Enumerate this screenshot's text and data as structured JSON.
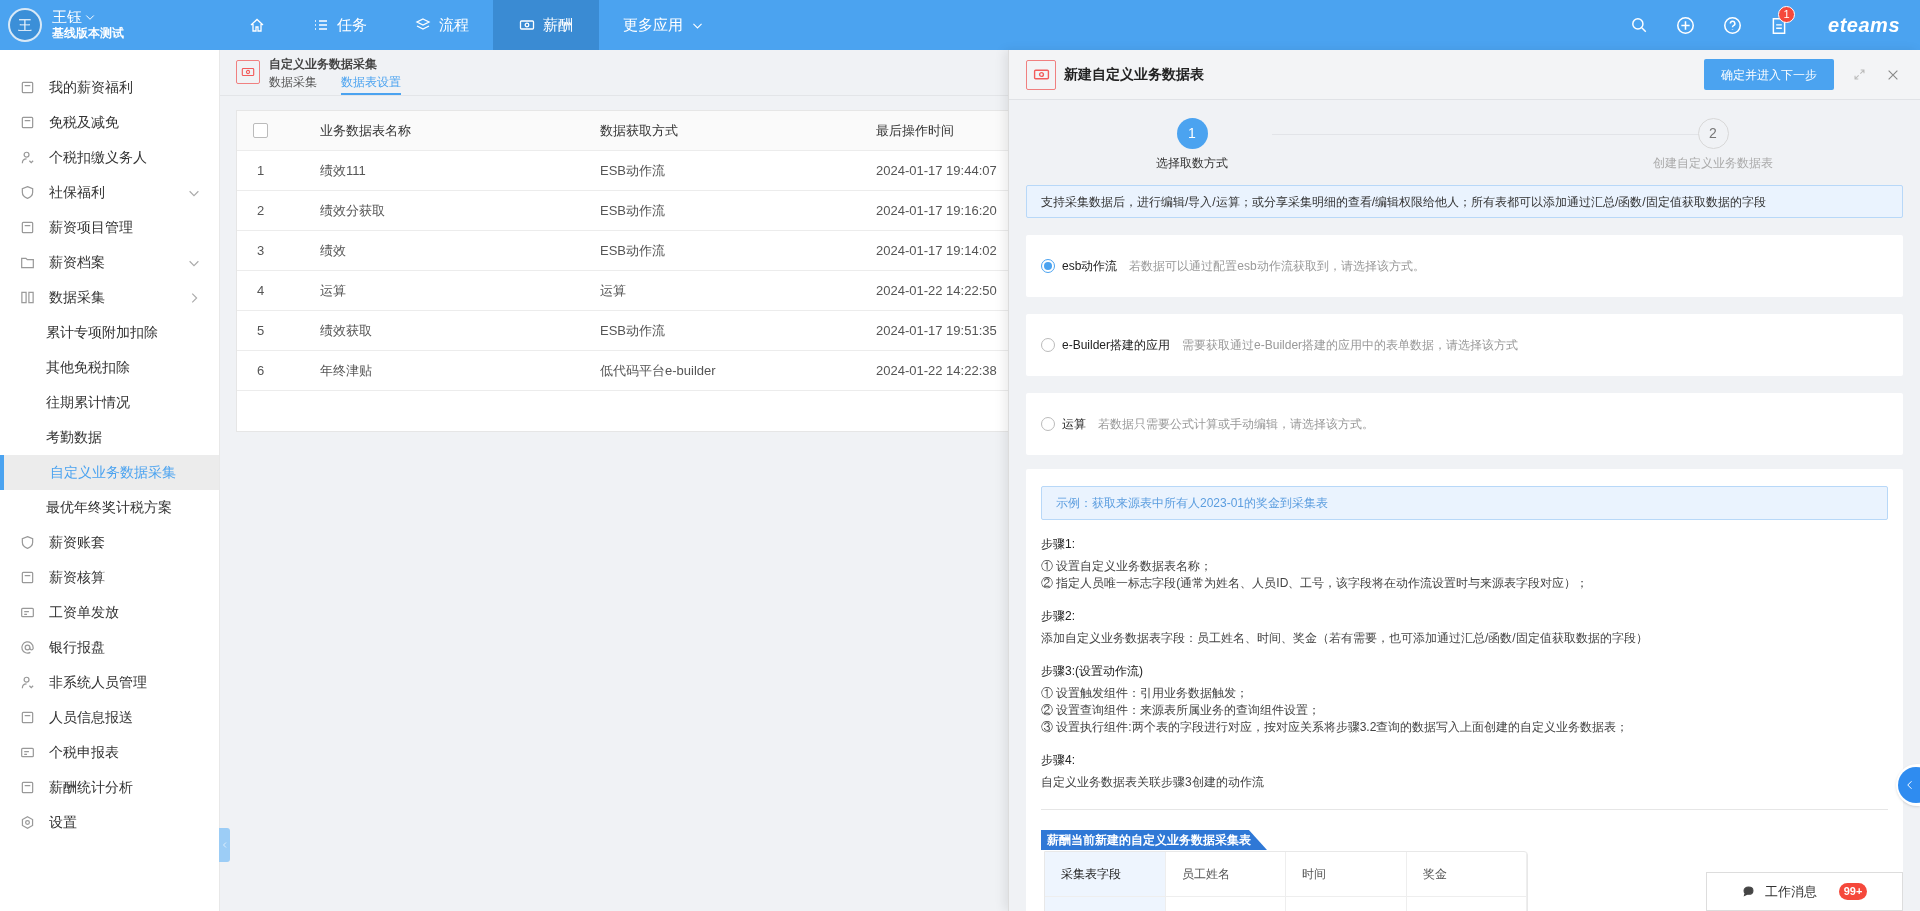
{
  "user": {
    "avatar_letter": "王",
    "name": "王钰",
    "org": "基线版本测试"
  },
  "top_nav": [
    {
      "kind": "home",
      "selected": false
    },
    {
      "kind": "tasks",
      "label": "任务",
      "selected": false
    },
    {
      "kind": "flow",
      "label": "流程",
      "selected": false
    },
    {
      "kind": "salary",
      "label": "薪酬",
      "selected": true
    },
    {
      "kind": "more",
      "label": "更多应用",
      "selected": false
    }
  ],
  "top_actions": {
    "notification_count": "1",
    "logo": "eteams"
  },
  "sidebar": {
    "items": [
      {
        "label": "我的薪资福利",
        "selected": false
      },
      {
        "label": "免税及减免",
        "selected": false
      },
      {
        "label": "个税扣缴义务人",
        "selected": false
      },
      {
        "label": "社保福利",
        "selected": false,
        "expanded": false
      },
      {
        "label": "薪资项目管理",
        "selected": false
      },
      {
        "label": "薪资档案",
        "selected": false,
        "expanded": false
      },
      {
        "label": "数据采集",
        "selected": false,
        "expanded": true,
        "children": [
          {
            "label": "累计专项附加扣除",
            "selected": false
          },
          {
            "label": "其他免税扣除",
            "selected": false
          },
          {
            "label": "往期累计情况",
            "selected": false
          },
          {
            "label": "考勤数据",
            "selected": false
          },
          {
            "label": "自定义业务数据采集",
            "selected": true
          },
          {
            "label": "最优年终奖计税方案",
            "selected": false
          }
        ]
      },
      {
        "label": "薪资账套",
        "selected": false
      },
      {
        "label": "薪资核算",
        "selected": false
      },
      {
        "label": "工资单发放",
        "selected": false
      },
      {
        "label": "银行报盘",
        "selected": false
      },
      {
        "label": "非系统人员管理",
        "selected": false
      },
      {
        "label": "人员信息报送",
        "selected": false
      },
      {
        "label": "个税申报表",
        "selected": false
      },
      {
        "label": "薪酬统计分析",
        "selected": false
      },
      {
        "label": "设置",
        "selected": false
      }
    ]
  },
  "page": {
    "title": "自定义业务数据采集",
    "tabs": [
      {
        "label": "数据采集",
        "selected": false
      },
      {
        "label": "数据表设置",
        "selected": true
      }
    ]
  },
  "table": {
    "select_all": {
      "checked": false
    },
    "columns": [
      "",
      "业务数据表名称",
      "数据获取方式",
      "最后操作时间"
    ],
    "rows": [
      [
        "1",
        "绩效111",
        "ESB动作流",
        "2024-01-17 19:44:07"
      ],
      [
        "2",
        "绩效分获取",
        "ESB动作流",
        "2024-01-17 19:16:20"
      ],
      [
        "3",
        "绩效",
        "ESB动作流",
        "2024-01-17 19:14:02"
      ],
      [
        "4",
        "运算",
        "运算",
        "2024-01-22 14:22:50"
      ],
      [
        "5",
        "绩效获取",
        "ESB动作流",
        "2024-01-17 19:51:35"
      ],
      [
        "6",
        "年终津贴",
        "低代码平台e-builder",
        "2024-01-22 14:22:38"
      ]
    ]
  },
  "drawer": {
    "title": "新建自定义业务数据表",
    "primary_button": "确定并进入下一步",
    "steps": [
      {
        "number": "1",
        "label": "选择取数方式",
        "selected": true
      },
      {
        "number": "2",
        "label": "创建自定义业务数据表",
        "selected": false
      }
    ],
    "info": "支持采集数据后，进行编辑/导入/运算；或分享采集明细的查看/编辑权限给他人；所有表都可以添加通过汇总/函数/固定值获取数据的字段",
    "options": [
      {
        "label": "esb动作流",
        "description": "若数据可以通过配置esb动作流获取到，请选择该方式。",
        "selected": true
      },
      {
        "label": "e-Builder搭建的应用",
        "description": "需要获取通过e-Builder搭建的应用中的表单数据，请选择该方式",
        "selected": false
      },
      {
        "label": "运算",
        "description": "若数据只需要公式计算或手动编辑，请选择该方式。",
        "selected": false
      }
    ],
    "example": {
      "banner": "示例：获取来源表中所有人2023-01的奖金到采集表",
      "sections": [
        {
          "heading": "步骤1:",
          "lines": [
            "① 设置自定义业务数据表名称；",
            "② 指定人员唯一标志字段(通常为姓名、人员ID、工号，该字段将在动作流设置时与来源表字段对应）；"
          ]
        },
        {
          "heading": "步骤2:",
          "lines": [
            "添加自定义业务数据表字段：员工姓名、时间、奖金（若有需要，也可添加通过汇总/函数/固定值获取数据的字段）"
          ]
        },
        {
          "heading": "步骤3:(设置动作流)",
          "lines": [
            "① 设置触发组件：引用业务数据触发；",
            "② 设置查询组件：来源表所属业务的查询组件设置；",
            "③ 设置执行组件:两个表的字段进行对应，按对应关系将步骤3.2查询的数据写入上面创建的自定义业务数据表；"
          ]
        },
        {
          "heading": "步骤4:",
          "lines": [
            "自定义业务数据表关联步骤3创建的动作流"
          ]
        }
      ],
      "sample_table": {
        "title": "薪酬当前新建的自定义业务数据采集表",
        "header": [
          "采集表字段",
          "员工姓名",
          "时间",
          "奖金"
        ]
      }
    }
  },
  "message_button": {
    "label": "工作消息",
    "count": "99+"
  }
}
